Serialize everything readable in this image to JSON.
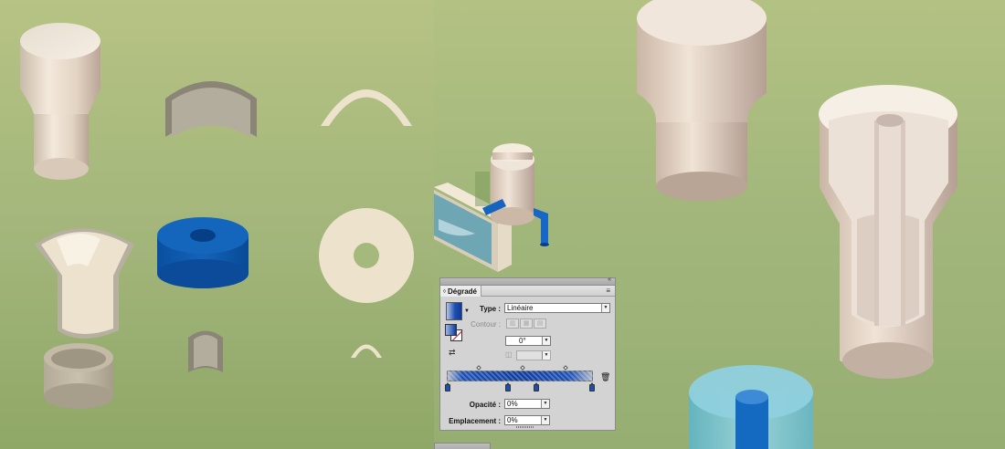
{
  "canvas": {
    "background_left": "#a8bb7e",
    "background_right": "#a5b87d",
    "accent_blue": "#0b3a9e",
    "cream": "#ede3cd"
  },
  "icons": {
    "collapse": "«",
    "close": "×",
    "panel_menu": "≡",
    "dropdown": "▼",
    "angle": "⊿",
    "trash": "🗑",
    "reverse": "⇄"
  },
  "gradient_panel": {
    "tab_label": "Dégradé",
    "type_label": "Type :",
    "type_value": "Linéaire",
    "contour_label": "Contour :",
    "angle_value": "0°",
    "aspect_value": "",
    "opacity_label": "Opacité :",
    "opacity_value": "0%",
    "location_label": "Emplacement :",
    "location_value": "0%",
    "stop_color": "#1c4fb0"
  }
}
